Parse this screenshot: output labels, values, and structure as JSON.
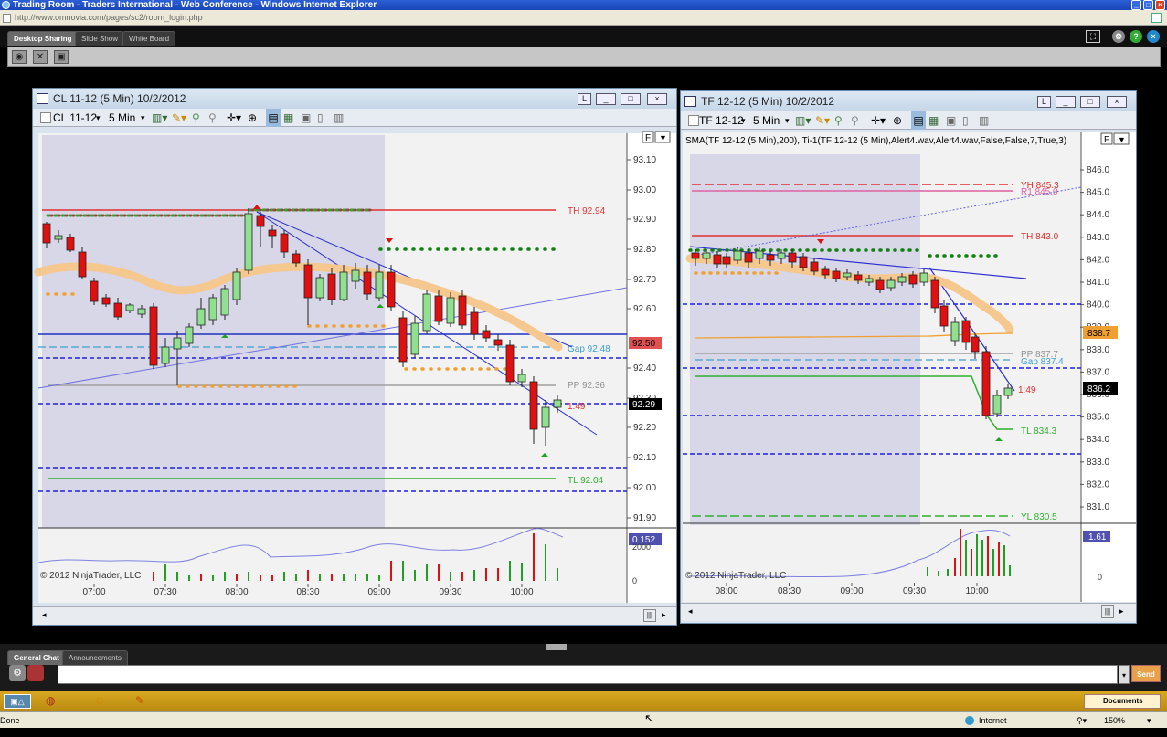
{
  "browser": {
    "title": "Trading Room - Traders International - Web Conference - Windows Internet Explorer",
    "address": "http://www.omnovia.com/pages/sc2/room_login.php",
    "status": "Done",
    "zone": "Internet",
    "zoom": "150%"
  },
  "app": {
    "tabs": [
      "Desktop Sharing",
      "Slide Show",
      "White Board"
    ],
    "chat_tabs": [
      "General Chat",
      "Announcements"
    ],
    "send_label": "Send",
    "documents_label": "Documents"
  },
  "chart_left": {
    "title": "CL 11-12 (5 Min)  10/2/2012",
    "instrument": "CL 11-12",
    "interval": "5 Min",
    "copyright": "© 2012 NinjaTrader, LLC",
    "y_ticks": [
      "93.10",
      "93.00",
      "92.90",
      "92.80",
      "92.70",
      "92.60",
      "92.40",
      "92.30",
      "92.20",
      "92.10",
      "92.00",
      "91.90"
    ],
    "x_ticks": [
      "07:00",
      "07:30",
      "08:00",
      "08:30",
      "09:00",
      "09:30",
      "10:00"
    ],
    "labels": {
      "th": "TH 92.94",
      "gap": "Gap 92.48",
      "pp": "PP 92.36",
      "tl": "TL 92.04",
      "countdown": "1:49",
      "last": "92.29",
      "blue_tag": "92.50",
      "vol_tag": "0.152",
      "vol_axis_top": "2000",
      "vol_axis_zero": "0"
    }
  },
  "chart_right": {
    "title": "TF 12-12 (5 Min)  10/2/2012",
    "instrument": "TF 12-12",
    "interval": "5 Min",
    "indicator_line": "SMA(TF  12-12  (5  Min),200),   Ti-1(TF  12-12  (5  Min),Alert4.wav,Alert4.wav,False,False,7,True,3)",
    "copyright": "© 2012 NinjaTrader, LLC",
    "y_ticks": [
      "846.0",
      "845.0",
      "844.0",
      "843.0",
      "842.0",
      "841.0",
      "840.0",
      "839.0",
      "838.0",
      "837.0",
      "836.0",
      "835.0",
      "834.0",
      "833.0",
      "832.0",
      "831.0"
    ],
    "x_ticks": [
      "08:00",
      "08:30",
      "09:00",
      "09:30",
      "10:00"
    ],
    "labels": {
      "yh": "YH 845.3",
      "r1": "R1 845.0",
      "th": "TH 843.0",
      "pp": "PP 837.7",
      "gap": "Gap 837.4",
      "countdown": "1:49",
      "tl": "TL 834.3",
      "yl": "YL 830.5",
      "orange_tag": "838.7",
      "last": "836.2",
      "vol_tag": "1.61",
      "vol_axis_zero": "0"
    }
  },
  "colors": {
    "up": "#90e090",
    "down": "#e01010",
    "th": "#e03030",
    "blue": "#2020e0",
    "green": "#20a020",
    "orange": "#f0a030",
    "pp": "#a0a0a0"
  }
}
